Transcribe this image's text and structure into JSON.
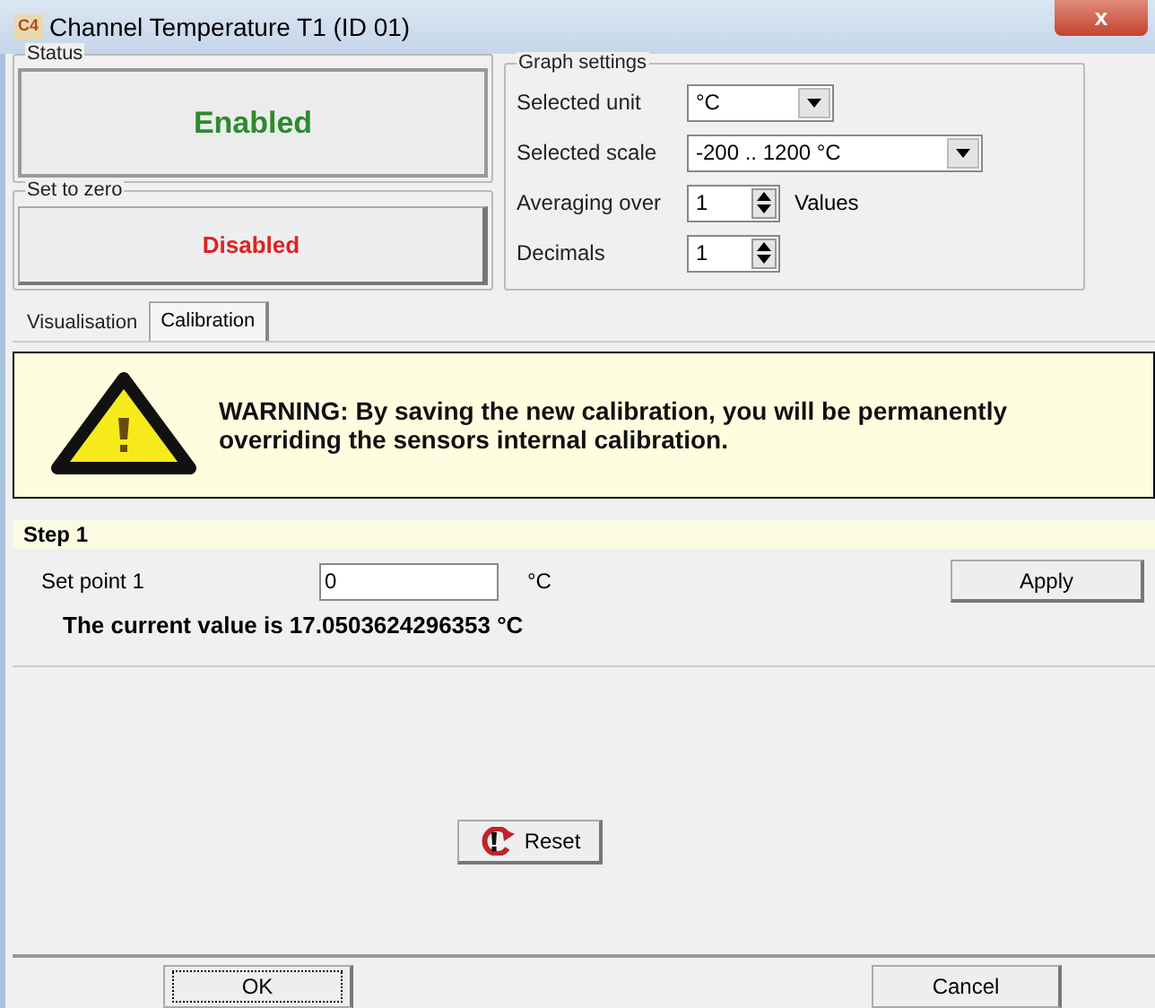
{
  "window": {
    "title": "Channel Temperature T1 (ID 01)",
    "app_badge": "C4",
    "close": "x"
  },
  "status": {
    "title": "Status",
    "value": "Enabled"
  },
  "set_to_zero": {
    "title": "Set to zero",
    "value": "Disabled"
  },
  "graph_settings": {
    "title": "Graph settings",
    "rows": [
      {
        "kind": "dropdown",
        "label": "Selected unit",
        "value": "°C"
      },
      {
        "kind": "dropdown",
        "label": "Selected scale",
        "value": "-200 .. 1200 °C"
      },
      {
        "kind": "spinner",
        "label": "Averaging over",
        "value": "1",
        "suffix": "Values"
      },
      {
        "kind": "spinner",
        "label": "Decimals",
        "value": "1"
      }
    ]
  },
  "tabs": [
    {
      "label": "Visualisation",
      "selected": false
    },
    {
      "label": "Calibration",
      "selected": true
    }
  ],
  "warning": "WARNING: By saving the new calibration, you will be permanently overriding the sensors internal calibration.",
  "step": {
    "title": "Step 1",
    "label": "Set point 1",
    "value": "0",
    "unit": "°C",
    "apply": "Apply",
    "current": "The current value is 17.0503624296353 °C"
  },
  "reset": "Reset",
  "buttons": [
    {
      "label": "OK",
      "focused": true
    },
    {
      "label": "Cancel",
      "focused": false
    }
  ]
}
